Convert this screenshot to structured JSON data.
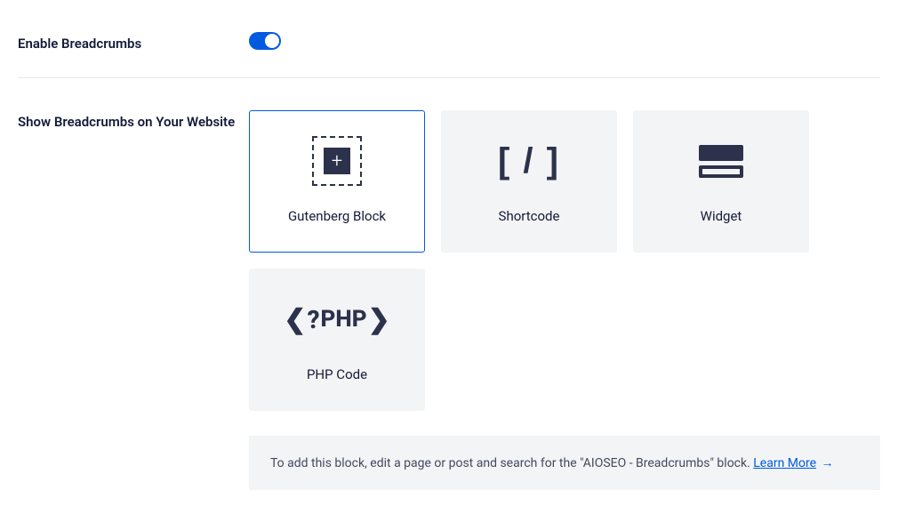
{
  "enable": {
    "label": "Enable Breadcrumbs"
  },
  "show": {
    "label": "Show Breadcrumbs on Your Website"
  },
  "cards": {
    "gutenberg": {
      "label": "Gutenberg Block"
    },
    "shortcode": {
      "label": "Shortcode"
    },
    "widget": {
      "label": "Widget"
    },
    "php": {
      "label": "PHP Code",
      "icon_text": "PHP"
    }
  },
  "notice": {
    "text": "To add this block, edit a page or post and search for the \"AIOSEO - Breadcrumbs\" block. ",
    "link_text": "Learn More",
    "arrow": "→"
  },
  "shortcode_glyph": "[ / ]"
}
